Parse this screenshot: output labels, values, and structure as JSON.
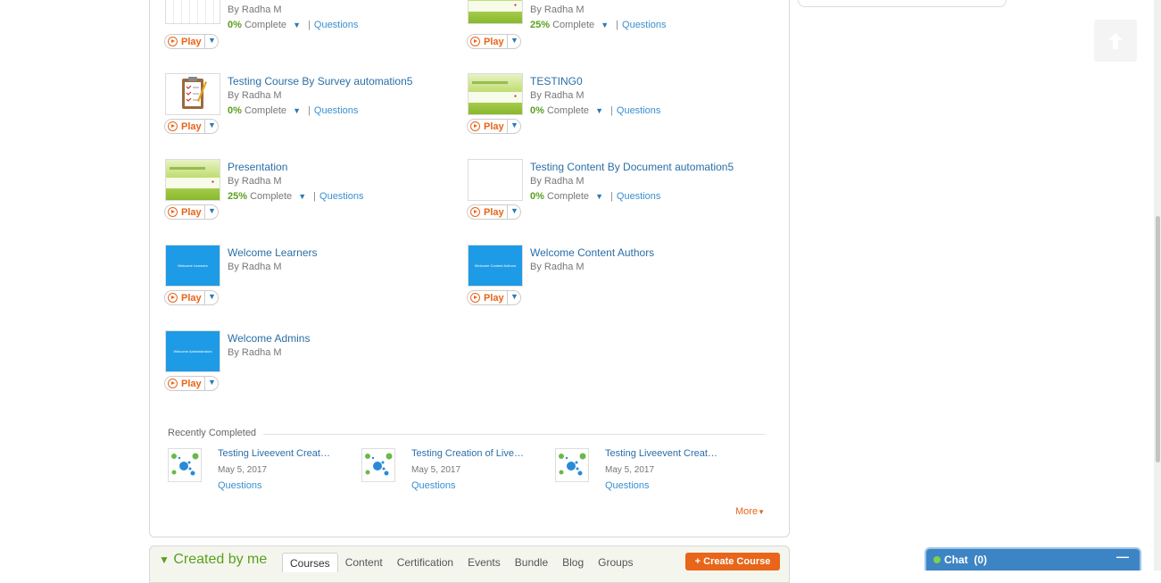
{
  "courses": [
    {
      "title": "",
      "author": "By Radha M",
      "percent": "0%",
      "complete_label": "Complete",
      "questions": "Questions",
      "play": "Play",
      "thumb": "grid"
    },
    {
      "title": "",
      "author": "By Radha M",
      "percent": "25%",
      "complete_label": "Complete",
      "questions": "Questions",
      "play": "Play",
      "thumb": "green"
    },
    {
      "title": "Testing Course By Survey automation5",
      "author": "By Radha M",
      "percent": "0%",
      "complete_label": "Complete",
      "questions": "Questions",
      "play": "Play",
      "thumb": "survey"
    },
    {
      "title": "TESTING0",
      "author": "By Radha M",
      "percent": "0%",
      "complete_label": "Complete",
      "questions": "Questions",
      "play": "Play",
      "thumb": "green"
    },
    {
      "title": "Presentation",
      "author": "By Radha M",
      "percent": "25%",
      "complete_label": "Complete",
      "questions": "Questions",
      "play": "Play",
      "thumb": "green"
    },
    {
      "title": "Testing Content By Document automation5",
      "author": "By Radha M",
      "percent": "0%",
      "complete_label": "Complete",
      "questions": "Questions",
      "play": "Play",
      "thumb": "blank"
    },
    {
      "title": "Welcome Learners",
      "author": "By Radha M",
      "play": "Play",
      "thumb": "blue",
      "thumb_text": "Welcome Learners"
    },
    {
      "title": "Welcome Content Authors",
      "author": "By Radha M",
      "play": "Play",
      "thumb": "blue",
      "thumb_text": "Welcome Content Authors"
    },
    {
      "title": "Welcome Admins",
      "author": "By Radha M",
      "play": "Play",
      "thumb": "blue",
      "thumb_text": "Welcome Administrators"
    }
  ],
  "recently_completed": {
    "heading": "Recently Completed",
    "items": [
      {
        "title": "Testing Liveevent Creat…",
        "date": "May 5, 2017",
        "questions": "Questions"
      },
      {
        "title": "Testing Creation of Live…",
        "date": "May 5, 2017",
        "questions": "Questions"
      },
      {
        "title": "Testing Liveevent Creat…",
        "date": "May 5, 2017",
        "questions": "Questions"
      }
    ],
    "more": "More"
  },
  "created_by_me": {
    "title": "Created by me",
    "tabs": [
      "Courses",
      "Content",
      "Certification",
      "Events",
      "Bundle",
      "Blog",
      "Groups"
    ],
    "active_tab": "Courses",
    "create_button": "+ Create Course"
  },
  "chat": {
    "label": "Chat",
    "count": "(0)",
    "status_color": "#7ed04a"
  },
  "colors": {
    "accent_orange": "#e8651a",
    "link_blue": "#2a6ea8",
    "progress_green": "#5aa01e"
  }
}
